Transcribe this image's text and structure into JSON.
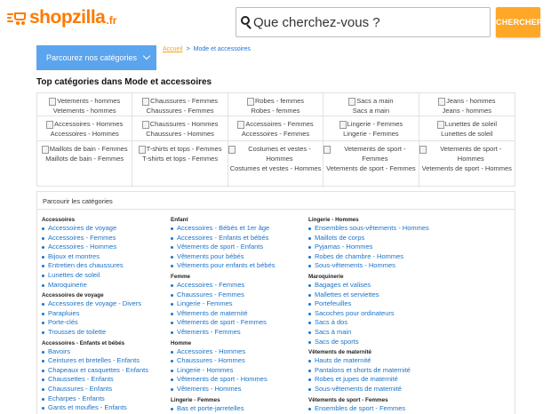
{
  "header": {
    "logo_text": "shopzilla",
    "logo_tld": ".fr",
    "search_placeholder": "Que cherchez-vous ?",
    "search_button": "CHERCHER",
    "browse_label": "Parcourez nos catégories"
  },
  "colors": {
    "brand_orange": "#ff7a00",
    "button_orange": "#ffa726",
    "browse_blue": "#5ba4ee",
    "link_blue": "#1a73c8"
  },
  "breadcrumb": {
    "home": "Accueil",
    "separator": ">",
    "current": "Mode et accessoires"
  },
  "top_title": "Top catégories dans Mode et accessoires",
  "tiles": [
    {
      "alt": "Vetements - hommes",
      "name": "Vetements - hommes"
    },
    {
      "alt": "Chaussures - Femmes",
      "name": "Chaussures - Femmes"
    },
    {
      "alt": "Robes - femmes",
      "name": "Robes - femmes"
    },
    {
      "alt": "Sacs a main",
      "name": "Sacs a main"
    },
    {
      "alt": "Jeans - hommes",
      "name": "Jeans - hommes"
    },
    {
      "alt": "Accessoires - Hommes",
      "name": "Accessoires - Hommes"
    },
    {
      "alt": "Chaussures - Hommes",
      "name": "Chaussures - Hommes"
    },
    {
      "alt": "Accessoires - Femmes",
      "name": "Accessoires - Femmes"
    },
    {
      "alt": "Lingerie - Femmes",
      "name": "Lingerie - Femmes"
    },
    {
      "alt": "Lunettes de soleil",
      "name": "Lunettes de soleil"
    },
    {
      "alt": "Maillots de bain - Femmes",
      "name": "Maillots de bain - Femmes"
    },
    {
      "alt": "T-shirts et tops - Femmes",
      "name": "T-shirts et tops - Femmes"
    },
    {
      "alt": "Costumes et vestes - Hommes",
      "name": "Costumes et vestes - Hommes"
    },
    {
      "alt": "Vetements de sport - Femmes",
      "name": "Vetements de sport - Femmes"
    },
    {
      "alt": "Vetements de sport - Hommes",
      "name": "Vetements de sport - Hommes"
    }
  ],
  "browse_panel": {
    "title": "Parcourir les catégories",
    "columns": [
      [
        {
          "heading": "Accessoires",
          "items": [
            "Accessoires de voyage",
            "Accessoires - Femmes",
            "Accessoires - Hommes",
            "Bijoux et montres",
            "Entretien des chaussures",
            "Lunettes de soleil",
            "Maroquinerie"
          ]
        },
        {
          "heading": "Accessoires de voyage",
          "items": [
            "Accessoires de voyage - Divers",
            "Parapluies",
            "Porte-clés",
            "Trousses de toilette"
          ]
        },
        {
          "heading": "Accessoires - Enfants et bébés",
          "items": [
            "Bavoirs",
            "Ceintures et bretelles - Enfants",
            "Chapeaux et casquettes - Enfants",
            "Chaussettes - Enfants",
            "Chaussures - Enfants",
            "Echarpes - Enfants",
            "Gants et moufles - Enfants"
          ]
        }
      ],
      [
        {
          "heading": "Enfant",
          "items": [
            "Accessoires - Bébés et 1er âge",
            "Accessoires - Enfants et bébés",
            "Vêtements de sport - Enfants",
            "Vêtements pour bébés",
            "Vêtements pour enfants et bébés"
          ]
        },
        {
          "heading": "Femme",
          "items": [
            "Accessoires - Femmes",
            "Chaussures - Femmes",
            "Lingerie - Femmes",
            "Vêtements de maternité",
            "Vêtements de sport - Femmes",
            "Vêtements - Femmes"
          ]
        },
        {
          "heading": "Homme",
          "items": [
            "Accessoires - Hommes",
            "Chaussures - Hommes",
            "Lingerie - Hommes",
            "Vêtements de sport - Hommes",
            "Vêtements - Hommes"
          ]
        },
        {
          "heading": "Lingerie - Femmes",
          "items": [
            "Bas et porte-jarretelles"
          ]
        }
      ],
      [
        {
          "heading": "Lingerie - Hommes",
          "items": [
            "Ensembles sous-vêtements - Hommes",
            "Maillots de corps",
            "Pyjamas - Hommes",
            "Robes de chambre - Hommes",
            "Sous-vêtements - Hommes"
          ]
        },
        {
          "heading": "Maroquinerie",
          "items": [
            "Bagages et valises",
            "Mallettes et serviettes",
            "Portefeuilles",
            "Sacoches pour ordinateurs",
            "Sacs à dos",
            "Sacs à main",
            "Sacs de sports"
          ]
        },
        {
          "heading": "Vêtements de maternité",
          "items": [
            "Hauts de maternité",
            "Pantalons et shorts de maternité",
            "Robes et jupes de maternité",
            "Sous-vêtements de maternité"
          ]
        },
        {
          "heading": "Vêtements de sport - Femmes",
          "items": [
            "Ensembles de sport - Femmes"
          ]
        }
      ]
    ]
  }
}
